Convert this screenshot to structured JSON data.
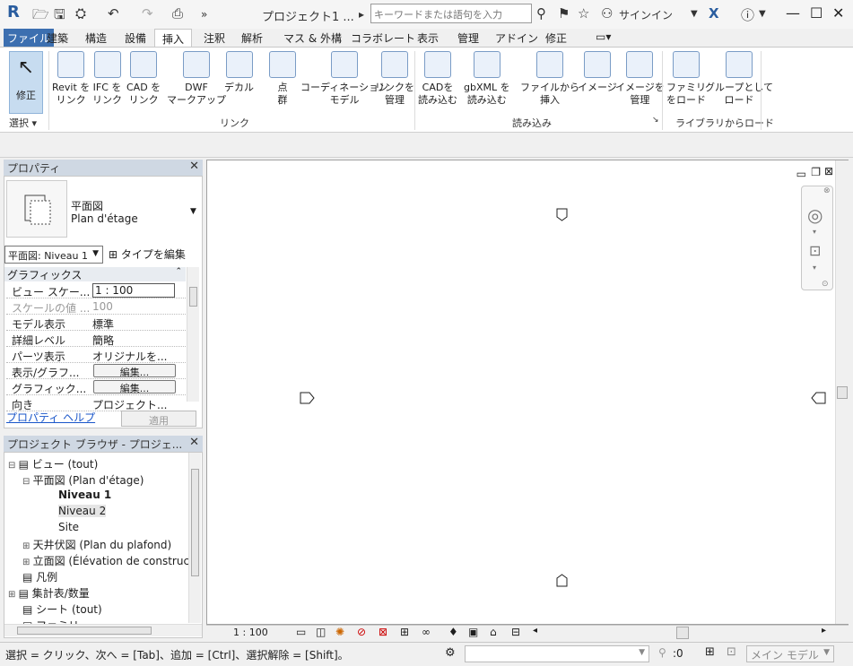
{
  "titlebar": {
    "app_icon": "R",
    "title": "プロジェクト1 ...",
    "search_placeholder": "キーワードまたは語句を入力",
    "sign_in": "サインイン"
  },
  "tabs": [
    "ファイル",
    "建築",
    "構造",
    "設備",
    "挿入",
    "注釈",
    "解析",
    "マス & 外構",
    "コラボレート",
    "表示",
    "管理",
    "アドイン",
    "修正"
  ],
  "active_tab": "挿入",
  "ribbon": {
    "modify": "修正",
    "select_group": "選択",
    "buttons_link": [
      {
        "l1": "Revit を",
        "l2": "リンク"
      },
      {
        "l1": "IFC を",
        "l2": "リンク"
      },
      {
        "l1": "CAD を",
        "l2": "リンク"
      },
      {
        "l1": "DWF",
        "l2": "マークアップ"
      },
      {
        "l1": "デカル",
        "l2": ""
      },
      {
        "l1": "点",
        "l2": "群"
      },
      {
        "l1": "コーディネーション",
        "l2": "モデル"
      },
      {
        "l1": "リンクを",
        "l2": "管理"
      }
    ],
    "group_link": "リンク",
    "buttons_import": [
      {
        "l1": "CADを",
        "l2": "読み込む"
      },
      {
        "l1": "gbXML を",
        "l2": "読み込む"
      },
      {
        "l1": "ファイルから",
        "l2": "挿入"
      },
      {
        "l1": "イメージ",
        "l2": ""
      },
      {
        "l1": "イメージを",
        "l2": "管理"
      }
    ],
    "group_import": "読み込み",
    "buttons_library": [
      {
        "l1": "ファミリ",
        "l2": "をロード"
      },
      {
        "l1": "グループとして",
        "l2": "ロード"
      }
    ],
    "group_library": "ライブラリからロード"
  },
  "properties": {
    "header": "プロパティ",
    "type_name1": "平面図",
    "type_name2": "Plan d'étage",
    "view_selector": "平面図: Niveau 1",
    "edit_type": "タイプを編集",
    "section": "グラフィックス",
    "rows": [
      {
        "label": "ビュー スケー...",
        "value": "1 : 100"
      },
      {
        "label": "スケールの値 ...",
        "value": "100"
      },
      {
        "label": "モデル表示",
        "value": "標準"
      },
      {
        "label": "詳細レベル",
        "value": "簡略"
      },
      {
        "label": "パーツ表示",
        "value": "オリジナルを..."
      },
      {
        "label": "表示/グラフ...",
        "value": "編集..."
      },
      {
        "label": "グラフィック...",
        "value": "編集..."
      },
      {
        "label": "向き",
        "value": "プロジェクト..."
      }
    ],
    "help": "プロパティ ヘルプ",
    "apply": "適用"
  },
  "browser": {
    "header": "プロジェクト ブラウザ - プロジェ...",
    "nodes": [
      {
        "text": "ビュー (tout)",
        "bold": false
      },
      {
        "text": "平面図 (Plan d'étage)",
        "bold": false
      },
      {
        "text": "Niveau 1",
        "bold": true
      },
      {
        "text": "Niveau 2",
        "bold": false
      },
      {
        "text": "Site",
        "bold": false
      },
      {
        "text": "天井伏図 (Plan du plafond)",
        "bold": false
      },
      {
        "text": "立面図 (Élévation de construc",
        "bold": false
      },
      {
        "text": "凡例",
        "bold": false
      },
      {
        "text": "集計表/数量",
        "bold": false
      },
      {
        "text": "シート (tout)",
        "bold": false
      },
      {
        "text": "ファミリ",
        "bold": false
      }
    ]
  },
  "view_control": {
    "scale": "1 : 100"
  },
  "status": {
    "text": "選択 = クリック、次へ = [Tab]、追加 = [Ctrl]、選択解除 = [Shift]。",
    "filter_count": ":0",
    "model": "メイン モデル"
  }
}
